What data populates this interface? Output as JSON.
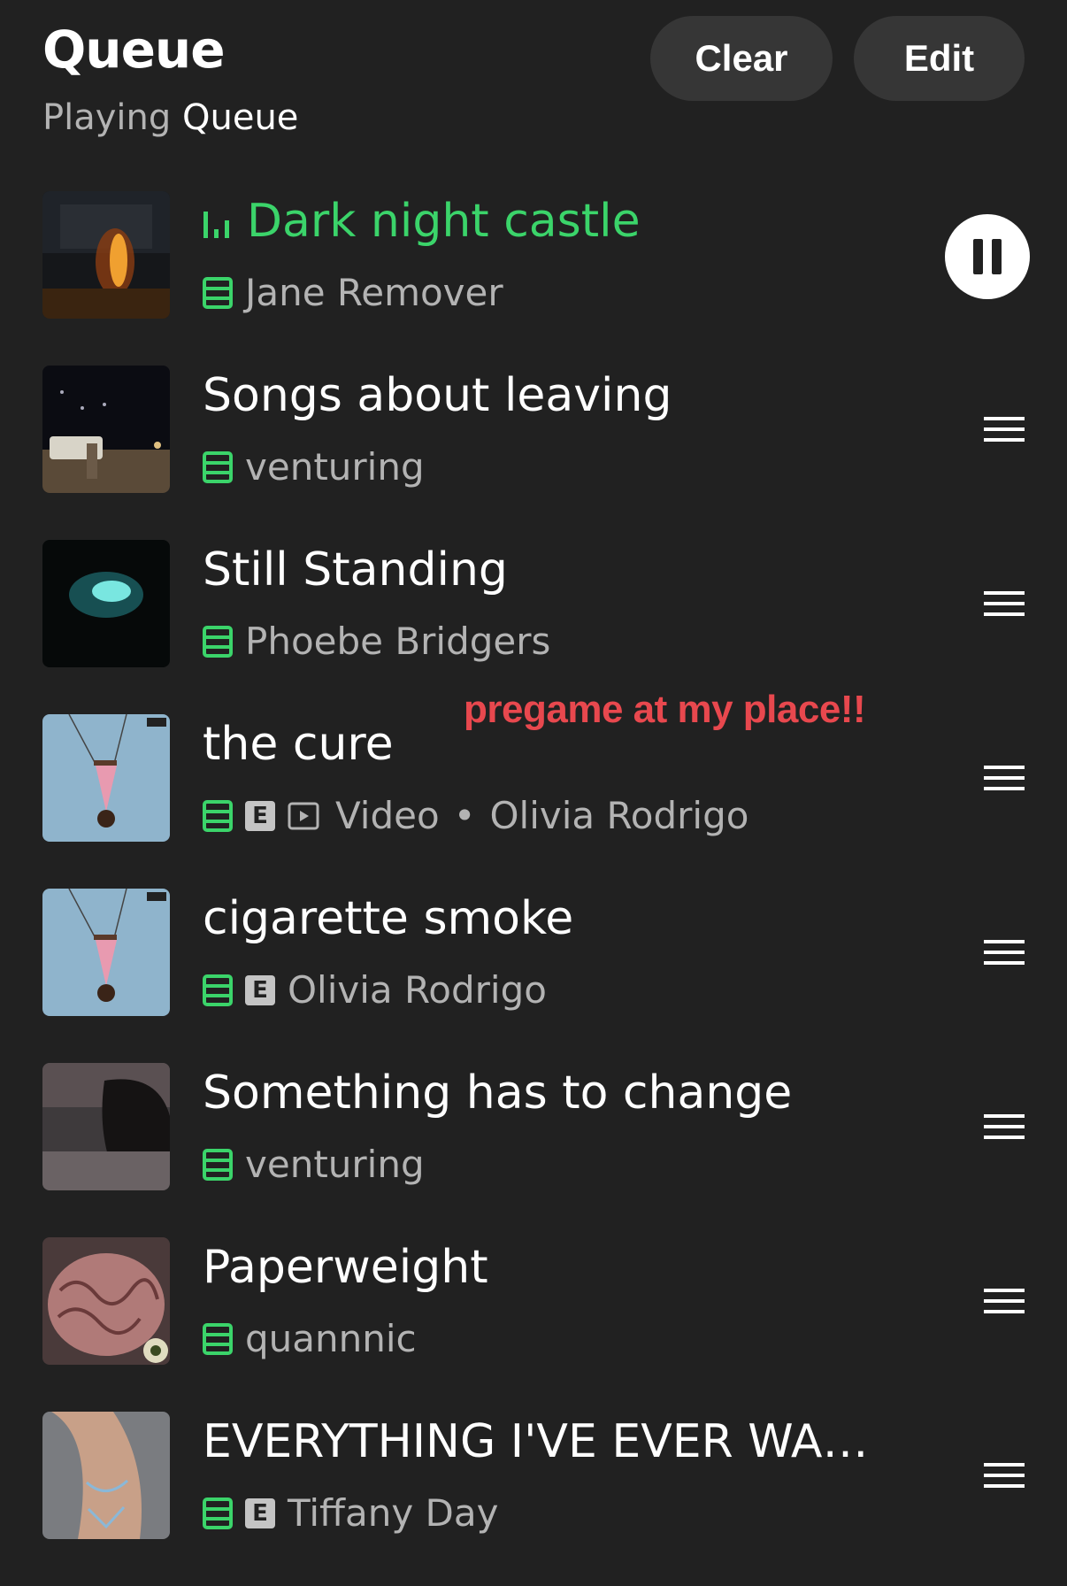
{
  "header": {
    "title": "Queue",
    "subtitle_prefix": "Playing",
    "subtitle_strong": "Queue",
    "clear_label": "Clear",
    "edit_label": "Edit"
  },
  "annotation": "pregame at my place!!",
  "colors": {
    "background": "#212121",
    "accent_green": "#3bd46a",
    "annotation_red": "#e8484e",
    "secondary_text": "#b3b3b3"
  },
  "queue": [
    {
      "title": "Dark night castle",
      "artist": "Jane Remover",
      "playing": true,
      "explicit": false,
      "video": false
    },
    {
      "title": "Songs about leaving",
      "artist": "venturing",
      "playing": false,
      "explicit": false,
      "video": false
    },
    {
      "title": "Still Standing",
      "artist": "Phoebe Bridgers",
      "playing": false,
      "explicit": false,
      "video": false
    },
    {
      "title": "the cure",
      "artist": "Olivia Rodrigo",
      "playing": false,
      "explicit": true,
      "video": true,
      "video_label": "Video",
      "separator": "•"
    },
    {
      "title": "cigarette smoke",
      "artist": "Olivia Rodrigo",
      "playing": false,
      "explicit": true,
      "video": false
    },
    {
      "title": "Something has to change",
      "artist": "venturing",
      "playing": false,
      "explicit": false,
      "video": false
    },
    {
      "title": "Paperweight",
      "artist": "quannnic",
      "playing": false,
      "explicit": false,
      "video": false
    },
    {
      "title": "EVERYTHING I'VE EVER WAN...",
      "artist": "Tiffany Day",
      "playing": false,
      "explicit": true,
      "video": false
    }
  ],
  "badge_explicit": "E",
  "icons": {
    "downloaded": "downloaded-icon",
    "explicit": "explicit-badge",
    "video": "video-icon",
    "drag": "drag-handle-icon",
    "pause": "pause-icon",
    "now_playing": "now-playing-bars-icon"
  }
}
